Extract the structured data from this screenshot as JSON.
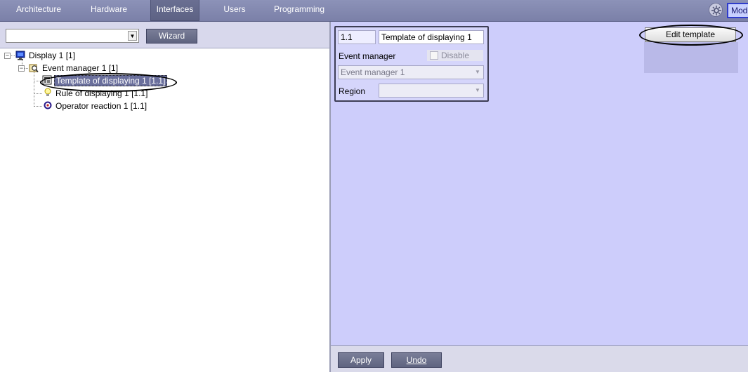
{
  "tabs": [
    {
      "label": "Architecture",
      "active": false
    },
    {
      "label": "Hardware",
      "active": false
    },
    {
      "label": "Interfaces",
      "active": true
    },
    {
      "label": "Users",
      "active": false
    },
    {
      "label": "Programming",
      "active": false
    }
  ],
  "topbar": {
    "mode_label": "Mode",
    "settings_icon": "gear-icon"
  },
  "left": {
    "combo_value": "",
    "wizard_label": "Wizard",
    "tree": [
      {
        "label": "Display 1 [1]",
        "icon": "monitor-icon",
        "level": 0,
        "expanded": true,
        "selected": false
      },
      {
        "label": "Event manager 1 [1]",
        "icon": "event-manager-icon",
        "level": 1,
        "expanded": true,
        "selected": false
      },
      {
        "label": "Template of displaying 1 [1.1]",
        "icon": "template-icon",
        "level": 2,
        "selected": true
      },
      {
        "label": "Rule of displaying 1 [1.1]",
        "icon": "lightbulb-icon",
        "level": 2,
        "selected": false
      },
      {
        "label": "Operator reaction 1 [1.1]",
        "icon": "operator-reaction-icon",
        "level": 2,
        "selected": false
      }
    ]
  },
  "props": {
    "id_value": "1.1",
    "name_value": "Template of displaying 1",
    "event_manager_label": "Event manager",
    "disable_label": "Disable",
    "disable_checked": false,
    "event_manager_value": "Event manager 1",
    "region_label": "Region",
    "region_value": ""
  },
  "edit_template_label": "Edit template",
  "bottom": {
    "apply_label": "Apply",
    "undo_label": "Undo"
  },
  "colors": {
    "topbar": "#7b80a8",
    "panel": "#cdcdfb",
    "selection": "#6a6f9c",
    "highlight_circle": "#000000"
  }
}
